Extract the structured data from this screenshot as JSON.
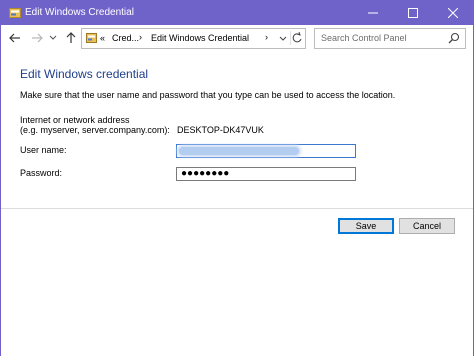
{
  "window": {
    "title": "Edit Windows Credential",
    "title_bar_color": "#6f63c9"
  },
  "titlebar_buttons": {
    "minimize": "minimize-icon",
    "maximize": "maximize-icon",
    "close": "close-icon"
  },
  "nav": {
    "back": "back-arrow-icon",
    "forward": "forward-arrow-icon",
    "recent": "chevron-down-icon",
    "up": "up-arrow-icon"
  },
  "address_bar": {
    "overflow": "«",
    "crumbs": [
      "Cred...",
      "Edit Windows Credential"
    ],
    "separator": "›",
    "refresh": "refresh-icon"
  },
  "search": {
    "placeholder": "Search Control Panel"
  },
  "content": {
    "heading": "Edit Windows credential",
    "heading_color": "#1e3f8a",
    "instruction": "Make sure that the user name and password that you type can be used to access the location.",
    "address_label_line1": "Internet or network address",
    "address_label_line2": "(e.g. myserver, server.company.com):",
    "address_value": "DESKTOP-DK47VUK",
    "username_label": "User name:",
    "password_label": "Password:",
    "password_mask": "●●●●●●●●"
  },
  "buttons": {
    "save": "Save",
    "cancel": "Cancel"
  }
}
